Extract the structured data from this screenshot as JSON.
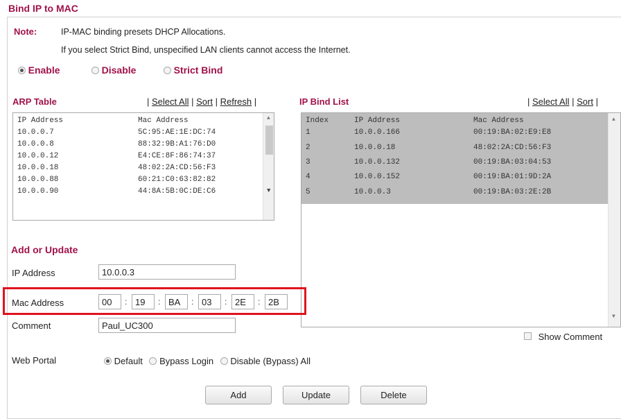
{
  "page": {
    "title": "Bind IP to MAC",
    "note_label": "Note:",
    "note_lines": [
      "IP-MAC binding presets DHCP Allocations.",
      "If you select Strict Bind, unspecified LAN clients cannot access the Internet."
    ]
  },
  "mode": {
    "options": [
      "Enable",
      "Disable",
      "Strict Bind"
    ],
    "selected": "Enable"
  },
  "arp_table": {
    "heading": "ARP Table",
    "actions": [
      "Select All",
      "Sort",
      "Refresh"
    ],
    "columns": [
      "IP Address",
      "Mac Address"
    ],
    "rows": [
      [
        "10.0.0.7",
        "5C:95:AE:1E:DC:74"
      ],
      [
        "10.0.0.8",
        "88:32:9B:A1:76:D0"
      ],
      [
        "10.0.0.12",
        "E4:CE:8F:86:74:37"
      ],
      [
        "10.0.0.18",
        "48:02:2A:CD:56:F3"
      ],
      [
        "10.0.0.88",
        "60:21:C0:63:82:82"
      ],
      [
        "10.0.0.90",
        "44:8A:5B:0C:DE:C6"
      ]
    ]
  },
  "ip_bind_list": {
    "heading": "IP Bind List",
    "actions": [
      "Select All",
      "Sort"
    ],
    "columns": [
      "Index",
      "IP Address",
      "Mac Address"
    ],
    "rows": [
      [
        "1",
        "10.0.0.166",
        "00:19:BA:02:E9:E8"
      ],
      [
        "2",
        "10.0.0.18",
        "48:02:2A:CD:56:F3"
      ],
      [
        "3",
        "10.0.0.132",
        "00:19:BA:03:04:53"
      ],
      [
        "4",
        "10.0.0.152",
        "00:19:BA:01:9D:2A"
      ],
      [
        "5",
        "10.0.0.3",
        "00:19:BA:03:2E:2B"
      ]
    ]
  },
  "form": {
    "heading": "Add or Update",
    "ip_label": "IP Address",
    "ip_value": "10.0.0.3",
    "mac_label": "Mac Address",
    "mac_segments": [
      "00",
      "19",
      "BA",
      "03",
      "2E",
      "2B"
    ],
    "comment_label": "Comment",
    "comment_value": "Paul_UC300",
    "web_portal_label": "Web Portal",
    "web_portal_options": [
      "Default",
      "Bypass Login",
      "Disable (Bypass) All"
    ],
    "web_portal_selected": "Default",
    "show_comment_label": "Show Comment"
  },
  "buttons": {
    "add": "Add",
    "update": "Update",
    "delete": "Delete"
  },
  "colors": {
    "accent": "#a0124a",
    "highlight": "#e0131f",
    "selected_row": "#bdbdbd"
  }
}
